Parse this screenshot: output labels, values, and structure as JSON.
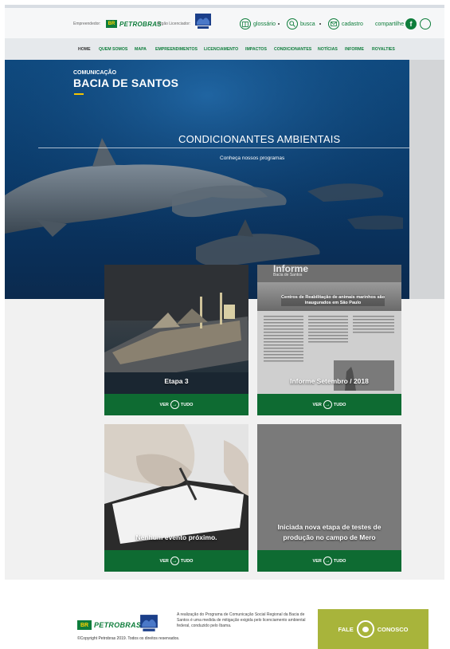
{
  "header": {
    "sponsor_label": "Empreendedor:",
    "licensor_label": "Órgão Licenciador:",
    "brand_badge": "BR",
    "brand_name": "PETROBRAS",
    "links": [
      {
        "label": "glossário",
        "icon": "book-icon"
      },
      {
        "label": "busca",
        "icon": "search-icon"
      },
      {
        "label": "cadastro",
        "icon": "signup-icon"
      }
    ],
    "share_label": "compartilhe",
    "social": [
      {
        "icon": "facebook-icon",
        "glyph": "f"
      },
      {
        "icon": "whatsapp-icon"
      }
    ]
  },
  "nav": {
    "items": [
      "HOME",
      "QUEM SOMOS",
      "MAPA",
      "EMPREENDIMENTOS",
      "LICENCIAMENTO",
      "IMPACTOS",
      "CONDICIONANTES",
      "NOTÍCIAS",
      "INFORME",
      "ROYALTIES"
    ],
    "active": "HOME"
  },
  "hero": {
    "subtitle": "COMUNICAÇÃO",
    "title": "BACIA DE SANTOS",
    "headline": "CONDICIONANTES AMBIENTAIS",
    "tagline": "Conheça nossos programas"
  },
  "cards": [
    {
      "caption": "Etapa 3",
      "button_left": "VER",
      "button_right": "TUDO"
    },
    {
      "caption": "Informe Setembro / 2018",
      "button_left": "VER",
      "button_right": "TUDO",
      "newsletter_title": "Informe",
      "newsletter_sub": "Bacia de Santos",
      "newsletter_headline": "Centros de Reabilitação de animais marinhos são inaugurados em São Paulo"
    },
    {
      "caption": "Nenhum evento próximo.",
      "button_left": "VER",
      "button_right": "TUDO"
    },
    {
      "caption": "Iniciada nova etapa de testes de produção no campo de Mero",
      "button_left": "VER",
      "button_right": "TUDO"
    }
  ],
  "footer": {
    "brand_badge": "BR",
    "brand_name": "PETROBRAS",
    "description": "A realização do Programa de Comunicação Social Regional da Bacia de Santos é uma medida de mitigação exigida pelo licenciamento ambiental federal, conduzido pelo Ibama.",
    "copyright": "©Copyright Petrobras 2019. Todos os direitos reservados.",
    "contact_left": "FALE",
    "contact_right": "CONOSCO"
  },
  "colors": {
    "brand_green": "#0e7d3b",
    "button_green": "#0e6b32",
    "accent_yellow": "#f5c400",
    "contact_olive": "#a8b43b",
    "hero_blue": "#0b3c6c"
  }
}
